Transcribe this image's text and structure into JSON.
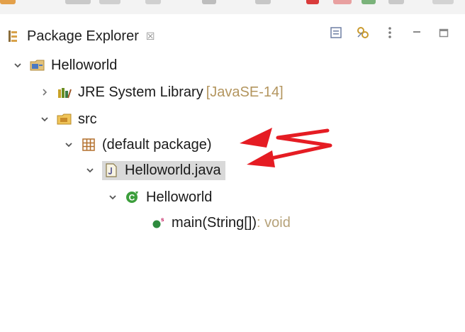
{
  "view": {
    "title": "Package Explorer",
    "close_glyph": "☒"
  },
  "tree": {
    "project": "Helloworld",
    "jre_label": "JRE System Library",
    "jre_version": "[JavaSE-14]",
    "src": "src",
    "default_package": "(default package)",
    "java_file": "Helloworld.java",
    "class_name": "Helloworld",
    "method_name": "main(String[])",
    "method_return": " : void"
  },
  "colors": {
    "annotation_red": "#e51c23",
    "selection_bg": "#d9d9d9",
    "folder_yellow": "#e8b546",
    "package_brown": "#b4712e",
    "class_green": "#3c9e3c",
    "method_green": "#2e8b3e"
  }
}
